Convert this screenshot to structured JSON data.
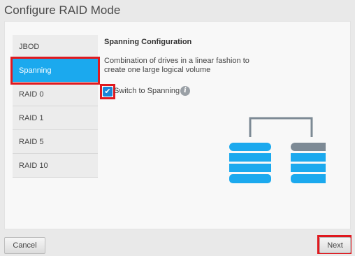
{
  "window": {
    "title": "Configure RAID Mode"
  },
  "sidebar": {
    "items": [
      {
        "label": "JBOD"
      },
      {
        "label": "Spanning"
      },
      {
        "label": "RAID 0"
      },
      {
        "label": "RAID 1"
      },
      {
        "label": "RAID 5"
      },
      {
        "label": "RAID 10"
      }
    ],
    "selected": "Spanning"
  },
  "content": {
    "heading": "Spanning Configuration",
    "description": "Combination of drives in a linear fashion to create one large logical volume",
    "checkbox_label": "Switch to Spanning",
    "checkbox_checked": true,
    "info_icon": "info-icon"
  },
  "footer": {
    "cancel_label": "Cancel",
    "next_label": "Next"
  },
  "colors": {
    "accent": "#1ba9ee",
    "highlight": "#e0191f",
    "drive_blue": "#1ba9ee",
    "drive_gray": "#7d8a95"
  }
}
